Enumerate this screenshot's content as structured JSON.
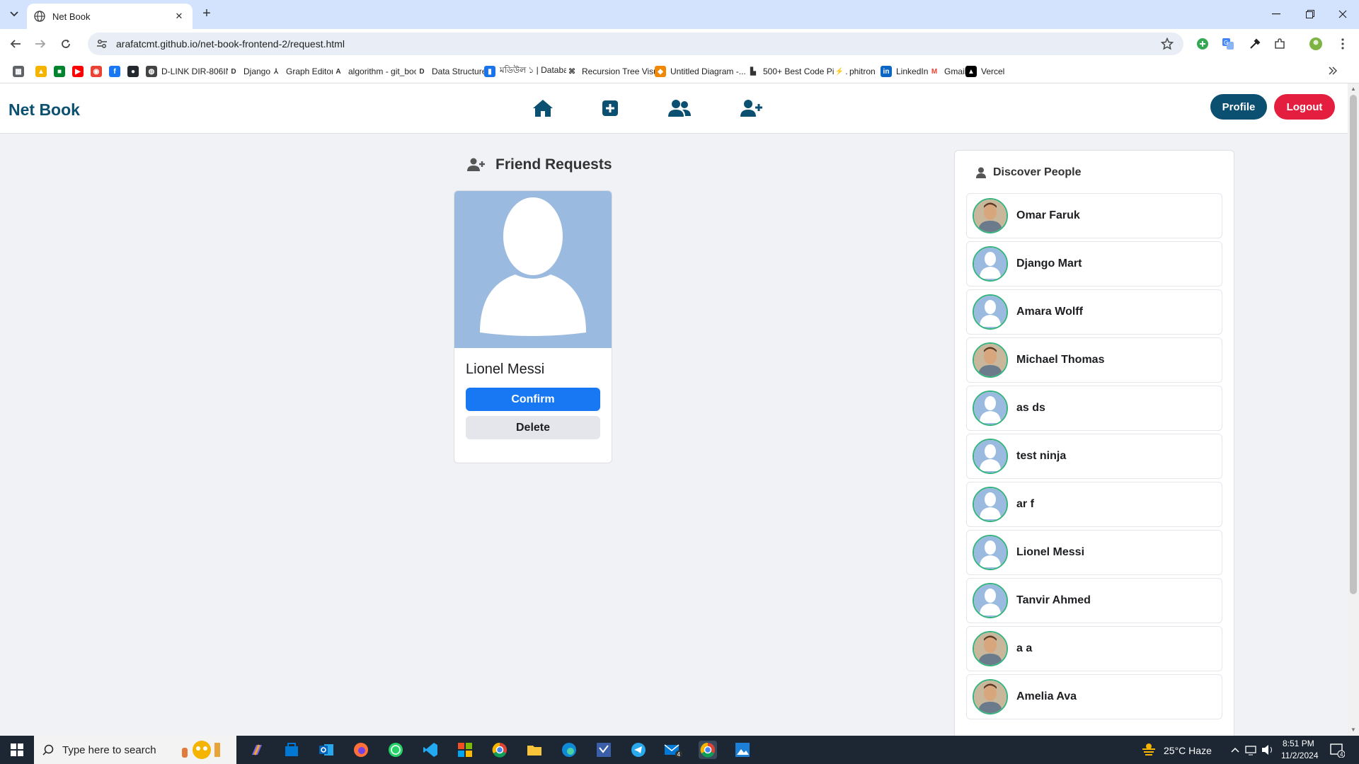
{
  "browser": {
    "tab_title": "Net Book",
    "url": "arafatcmt.github.io/net-book-frontend-2/request.html",
    "bookmarks": [
      {
        "label": "",
        "icon": "apps-icon"
      },
      {
        "label": "",
        "icon": "google-drive-icon"
      },
      {
        "label": "",
        "icon": "google-meet-icon"
      },
      {
        "label": "",
        "icon": "youtube-icon"
      },
      {
        "label": "",
        "icon": "chrome-web-icon"
      },
      {
        "label": "",
        "icon": "facebook-icon"
      },
      {
        "label": "",
        "icon": "github-icon"
      },
      {
        "label": "D-LINK DIR-806IN",
        "icon": "globe-icon"
      },
      {
        "label": "Django",
        "icon": "d-icon"
      },
      {
        "label": "Graph Editor",
        "icon": "graph-icon"
      },
      {
        "label": "algorithm - git_book",
        "icon": "a-icon"
      },
      {
        "label": "Data Structure",
        "icon": "d-icon"
      },
      {
        "label": "মডিউল ১ | Database",
        "icon": "doc-icon"
      },
      {
        "label": "Recursion Tree Visu...",
        "icon": "tree-icon"
      },
      {
        "label": "Untitled Diagram -...",
        "icon": "drawio-icon"
      },
      {
        "label": "500+ Best Code Pict...",
        "icon": "unsplash-icon"
      },
      {
        "label": "phitron",
        "icon": "phitron-icon"
      },
      {
        "label": "LinkedIn",
        "icon": "linkedin-icon"
      },
      {
        "label": "Gmail",
        "icon": "gmail-icon"
      },
      {
        "label": "Vercel",
        "icon": "vercel-icon"
      }
    ]
  },
  "app": {
    "brand": "Net Book",
    "profile_label": "Profile",
    "logout_label": "Logout"
  },
  "requests": {
    "heading": "Friend Requests",
    "items": [
      {
        "name": "Lionel Messi",
        "confirm_label": "Confirm",
        "delete_label": "Delete"
      }
    ]
  },
  "discover": {
    "heading": "Discover People",
    "people": [
      {
        "name": "Omar Faruk",
        "avatar": "photo"
      },
      {
        "name": "Django Mart",
        "avatar": "default"
      },
      {
        "name": "Amara Wolff",
        "avatar": "default"
      },
      {
        "name": "Michael Thomas",
        "avatar": "photo"
      },
      {
        "name": "as ds",
        "avatar": "default"
      },
      {
        "name": "test ninja",
        "avatar": "default"
      },
      {
        "name": "ar f",
        "avatar": "default"
      },
      {
        "name": "Lionel Messi",
        "avatar": "default"
      },
      {
        "name": "Tanvir Ahmed",
        "avatar": "default"
      },
      {
        "name": "a a",
        "avatar": "photo"
      },
      {
        "name": "Amelia Ava",
        "avatar": "photo"
      }
    ]
  },
  "taskbar": {
    "search_placeholder": "Type here to search",
    "weather": "25°C  Haze",
    "time": "8:51 PM",
    "date": "11/2/2024",
    "notification_count": "4"
  },
  "colors": {
    "brand": "#0b4f71",
    "logout": "#e41e3f",
    "confirm": "#1877f2",
    "avatar_bg": "#9bbadf",
    "avatar_ring": "#36b37e"
  }
}
